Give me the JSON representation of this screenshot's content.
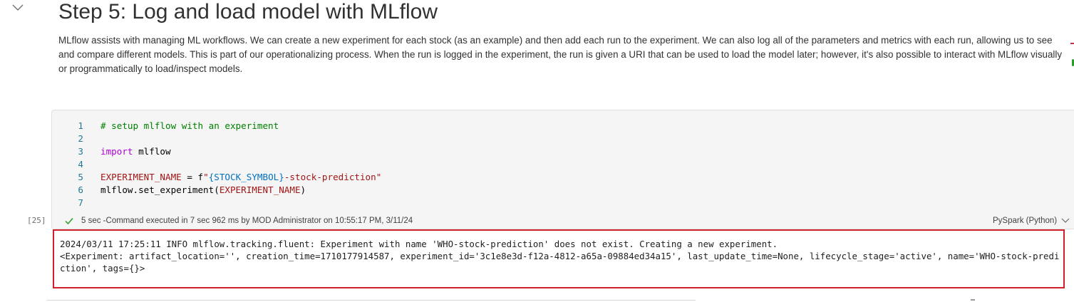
{
  "markdown_cell": {
    "title": "Step 5: Log and load model with MLflow",
    "paragraph": "MLflow assists with managing ML workflows. We can create a new experiment for each stock (as an example) and then add each run to the experiment. We can also log all of the parameters and metrics with each run, allowing us to see and compare different models. This is part of our operationalizing process. When the run is logged in the experiment, the run is given a URI that can be used to load the model later; however, it's also possible to interact with MLflow visually or programmatically to load/inspect models."
  },
  "code_cell": {
    "execution_count": "[25]",
    "lines": [
      {
        "no": "1",
        "comment": "# setup mlflow with an experiment"
      },
      {
        "no": "2"
      },
      {
        "no": "3",
        "keyword": "import",
        "rest": " mlflow"
      },
      {
        "no": "4"
      },
      {
        "no": "5",
        "const": "EXPERIMENT_NAME",
        "op": " = f",
        "str_open": "\"",
        "fvar": "{STOCK_SYMBOL}",
        "str_rest": "-stock-prediction\""
      },
      {
        "no": "6",
        "call": "mlflow.set_experiment(",
        "arg": "EXPERIMENT_NAME",
        "close": ")"
      },
      {
        "no": "7"
      }
    ],
    "status_text": "5 sec -Command executed in 7 sec 962 ms by MOD Administrator on 10:55:17 PM, 3/11/24",
    "language": "PySpark (Python)"
  },
  "output": {
    "text": "2024/03/11 17:25:11 INFO mlflow.tracking.fluent: Experiment with name 'WHO-stock-prediction' does not exist. Creating a new experiment.\n<Experiment: artifact_location='', creation_time=1710177914587, experiment_id='3c1e8e3d-f12a-4812-a65a-09884ed34a15', last_update_time=None, lifecycle_stage='active', name='WHO-stock-prediction', tags={}>"
  },
  "colors": {
    "output_highlight": "#d0202b",
    "status_success": "#2a9d2a"
  },
  "icons": {
    "collapse": "chevron-down-icon",
    "status": "checkmark-icon",
    "language_menu": "chevron-down-icon"
  }
}
